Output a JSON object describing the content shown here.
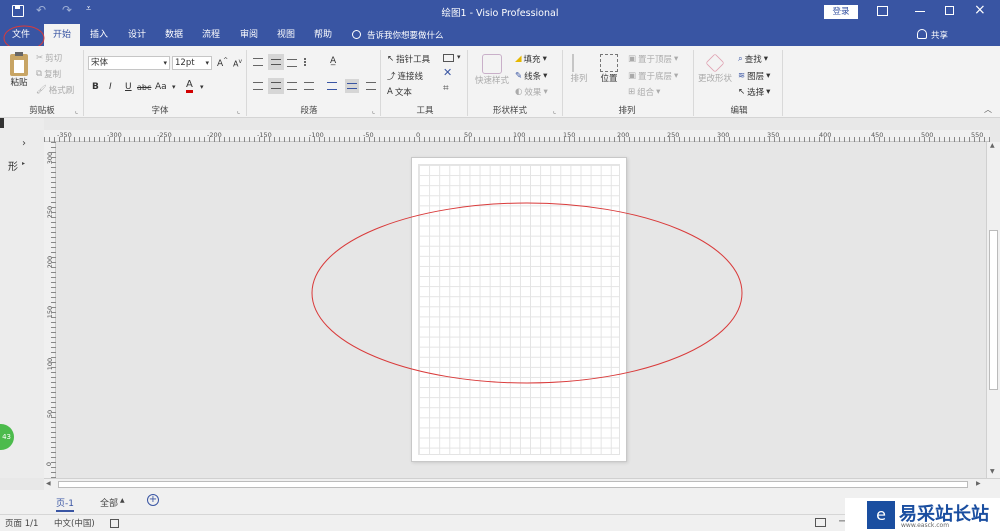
{
  "app": {
    "title": "绘图1 - Visio Professional",
    "login": "登录",
    "share": "共享",
    "tell_me": "告诉我你想要做什么"
  },
  "tabs": [
    "文件",
    "开始",
    "插入",
    "设计",
    "数据",
    "流程",
    "审阅",
    "视图",
    "帮助"
  ],
  "ribbon": {
    "clipboard": {
      "paste": "粘贴",
      "cut": "剪切",
      "copy": "复制",
      "format_painter": "格式刷",
      "label": "剪贴板"
    },
    "font": {
      "name": "宋体",
      "size": "12pt",
      "bold": "B",
      "italic": "I",
      "underline": "U",
      "strike": "abc",
      "case": "Aa",
      "color": "A",
      "label": "字体"
    },
    "paragraph": {
      "label": "段落"
    },
    "tools": {
      "pointer": "指针工具",
      "connector": "连接线",
      "text": "文本",
      "label": "工具"
    },
    "shape_styles": {
      "quick": "快速样式",
      "fill": "填充",
      "line": "线条",
      "effects": "效果",
      "label": "形状样式"
    },
    "arrange": {
      "align": "排列",
      "position": "位置",
      "front": "置于顶层",
      "back": "置于底层",
      "group": "组合",
      "label": "排列"
    },
    "editing": {
      "change_shape": "更改形状",
      "find": "查找",
      "layers": "图层",
      "select": "选择",
      "label": "编辑"
    }
  },
  "ruler_h": [
    "-350",
    "-300",
    "-250",
    "-200",
    "-150",
    "-100",
    "-50",
    "0",
    "50",
    "100",
    "150",
    "200",
    "250",
    "300",
    "350",
    "400",
    "450",
    "500",
    "550"
  ],
  "ruler_v": [
    "300",
    "250",
    "200",
    "150",
    "100",
    "50",
    "0"
  ],
  "shapes_pane": {
    "label": "形"
  },
  "badge": "43",
  "pages": {
    "page": "页-1",
    "all": "全部",
    "add": "+"
  },
  "status": {
    "page": "页面 1/1",
    "lang": "中文(中国)"
  },
  "watermark": {
    "text": "易采站长站",
    "sub": "www.easck.com"
  },
  "colors": {
    "titlebar": "#3955a3",
    "annotation": "#d93a3a",
    "accent": "#3955a3"
  }
}
